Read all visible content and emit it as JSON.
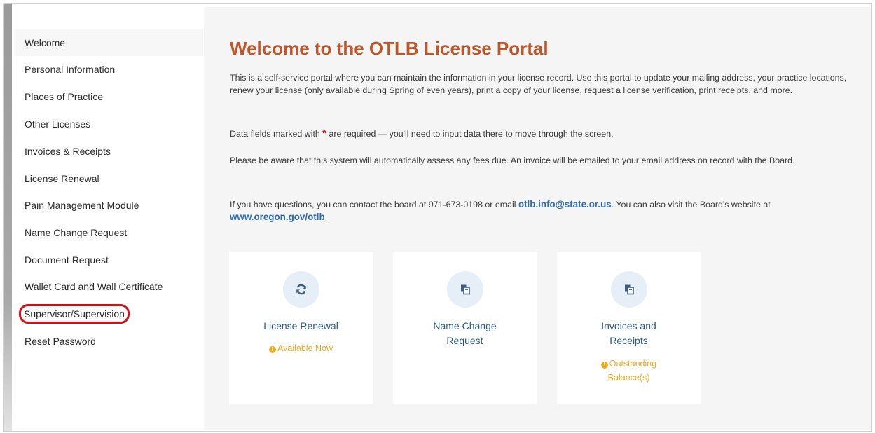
{
  "sidebar": {
    "items": [
      {
        "label": "Welcome"
      },
      {
        "label": "Personal Information"
      },
      {
        "label": "Places of Practice"
      },
      {
        "label": "Other Licenses"
      },
      {
        "label": "Invoices & Receipts"
      },
      {
        "label": "License Renewal"
      },
      {
        "label": "Pain Management Module"
      },
      {
        "label": "Name Change Request"
      },
      {
        "label": "Document Request"
      },
      {
        "label": "Wallet Card and Wall Certificate"
      },
      {
        "label": "Supervisor/Supervision"
      },
      {
        "label": "Reset Password"
      }
    ],
    "active_item": "Welcome",
    "highlighted_item": "Supervisor/Supervision"
  },
  "main": {
    "title": "Welcome to the OTLB License Portal",
    "intro": "This is a self-service portal where you can maintain the information in your license record. Use this portal to update your mailing address, your practice locations, renew your license (only available during Spring of even years), print a copy of your license, request a license verification, print receipts, and more.",
    "required_prefix": "Data fields marked with",
    "required_symbol": "*",
    "required_suffix": "are required — you'll need to input data there to move through the screen.",
    "fees_notice": "Please be aware that this system will automatically assess any fees due. An invoice will be emailed to your email address on record with the Board.",
    "contact_prefix": "If you have questions, you can contact the board at 971-673-0198 or email",
    "contact_email": "otlb.info@state.or.us",
    "contact_middle": ". You can also visit the Board's website at",
    "contact_website": "www.oregon.gov/otlb",
    "contact_suffix": "."
  },
  "cards": [
    {
      "title": "License Renewal",
      "icon": "refresh-icon",
      "status": "Available Now"
    },
    {
      "title": "Name Change Request",
      "icon": "documents-icon",
      "status": ""
    },
    {
      "title": "Invoices and Receipts",
      "icon": "documents-icon",
      "status": "Outstanding Balance(s)"
    }
  ],
  "colors": {
    "title": "#c1552a",
    "link": "#2f6db0",
    "card_title": "#2e5a87",
    "status": "#f0a91e",
    "highlight_ring": "#d80f19",
    "icon_circle": "#e6eef7"
  }
}
